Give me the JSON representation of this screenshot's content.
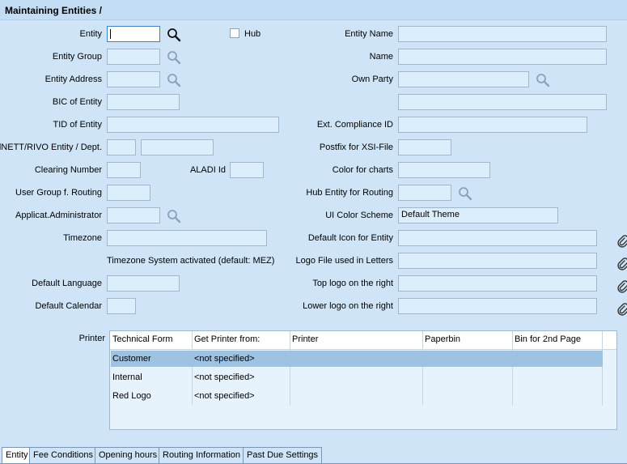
{
  "window": {
    "title": "Maintaining Entities /"
  },
  "form": {
    "entity": {
      "label": "Entity",
      "value": ""
    },
    "hub": {
      "label": "Hub",
      "checked": false
    },
    "entity_name": {
      "label": "Entity Name",
      "value": ""
    },
    "entity_group": {
      "label": "Entity Group",
      "value": ""
    },
    "name": {
      "label": "Name",
      "value": ""
    },
    "entity_address": {
      "label": "Entity Address",
      "value": ""
    },
    "own_party": {
      "label": "Own Party",
      "value": "",
      "value2": ""
    },
    "bic": {
      "label": "BIC of Entity",
      "value": ""
    },
    "tid": {
      "label": "TID of Entity",
      "value": ""
    },
    "ext_compliance": {
      "label": "Ext. Compliance ID",
      "value": ""
    },
    "allnett": {
      "label": "allNETT/RIVO Entity / Dept.",
      "value1": "",
      "value2": ""
    },
    "postfix": {
      "label": "Postfix for XSI-File",
      "value": ""
    },
    "clearing": {
      "label": "Clearing Number",
      "value": ""
    },
    "aladi": {
      "label": "ALADI Id",
      "value": ""
    },
    "color_charts": {
      "label": "Color for charts",
      "value": ""
    },
    "user_group": {
      "label": "User Group f. Routing",
      "value": ""
    },
    "hub_routing": {
      "label": "Hub Entity for Routing",
      "value": ""
    },
    "app_admin": {
      "label": "Applicat.Administrator",
      "value": ""
    },
    "ui_color": {
      "label": "UI Color Scheme",
      "value": "Default Theme"
    },
    "timezone": {
      "label": "Timezone",
      "value": ""
    },
    "default_icon": {
      "label": "Default Icon for Entity",
      "value": ""
    },
    "timezone_note": "Timezone System activated (default: MEZ)",
    "logo_letters": {
      "label": "Logo File used in Letters",
      "value": ""
    },
    "default_language": {
      "label": "Default Language",
      "value": ""
    },
    "top_logo": {
      "label": "Top logo on the right",
      "value": ""
    },
    "default_calendar": {
      "label": "Default Calendar",
      "value": ""
    },
    "lower_logo": {
      "label": "Lower logo on the right",
      "value": ""
    }
  },
  "printer": {
    "label": "Printer",
    "columns": [
      "Technical Form",
      "Get Printer from:",
      "Printer",
      "Paperbin",
      "Bin for 2nd Page"
    ],
    "rows": [
      {
        "form": "Customer",
        "get_from": "<not specified>",
        "printer": "",
        "paperbin": "",
        "bin2": ""
      },
      {
        "form": "Internal",
        "get_from": "<not specified>",
        "printer": "",
        "paperbin": "",
        "bin2": ""
      },
      {
        "form": "Red Logo",
        "get_from": "<not specified>",
        "printer": "",
        "paperbin": "",
        "bin2": ""
      }
    ],
    "selected_row": 0
  },
  "tabs": [
    {
      "label": "Entity",
      "active": true
    },
    {
      "label": "Fee Conditions",
      "active": false
    },
    {
      "label": "Opening hours",
      "active": false
    },
    {
      "label": "Routing Information",
      "active": false
    },
    {
      "label": "Past Due Settings",
      "active": false
    }
  ]
}
